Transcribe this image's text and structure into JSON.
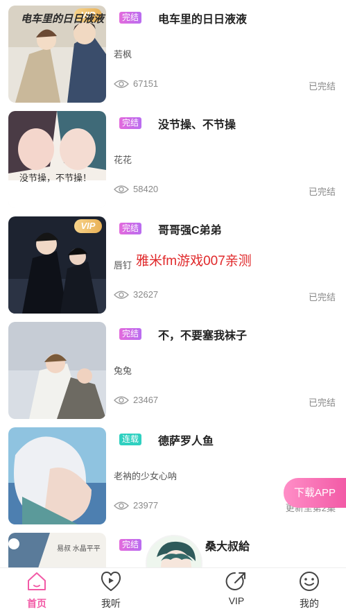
{
  "books": [
    {
      "status": "完结",
      "status_type": "done",
      "title": "电车里的日日液液",
      "author": "若枫",
      "views": "67151",
      "state": "已完结",
      "vip": true,
      "cover_text": "电车里的日日液液"
    },
    {
      "status": "完结",
      "status_type": "done",
      "title": "没节操、不节操",
      "author": "花花",
      "views": "58420",
      "state": "已完结",
      "vip": false,
      "cover_text": "没节操，不节操！"
    },
    {
      "status": "完结",
      "status_type": "done",
      "title": "哥哥强C弟弟",
      "author": "唇钉",
      "views": "32627",
      "state": "已完结",
      "vip": true,
      "cover_text": ""
    },
    {
      "status": "完结",
      "status_type": "done",
      "title": "不，不要塞我袜子",
      "author": "兔兔",
      "views": "23467",
      "state": "已完结",
      "vip": false,
      "cover_text": ""
    },
    {
      "status": "连载",
      "status_type": "ongoing",
      "title": "德萨罗人鱼",
      "author": "老衲的少女心呐",
      "views": "23977",
      "state": "更新至第2集",
      "vip": false,
      "cover_text": ""
    },
    {
      "status": "完结",
      "status_type": "done",
      "title": "桑大叔給",
      "author": "",
      "views": "",
      "state": "",
      "vip": false,
      "cover_text": "易叔 水晶平平"
    }
  ],
  "vip_badge_label": "VIP",
  "watermark": "雅米fm游戏007亲测",
  "download_button": "下载APP",
  "tabs": [
    {
      "label": "首页",
      "icon": "home-icon",
      "active": true
    },
    {
      "label": "我听",
      "icon": "play-heart-icon",
      "active": false
    },
    {
      "label": "VIP",
      "icon": "vip-arrow-icon",
      "active": false
    },
    {
      "label": "我的",
      "icon": "smile-icon",
      "active": false
    }
  ],
  "colors": {
    "accent": "#f25aa6",
    "tag_done": "#d86ae2",
    "tag_ongoing": "#2fd0c0",
    "watermark": "#e0282a"
  }
}
